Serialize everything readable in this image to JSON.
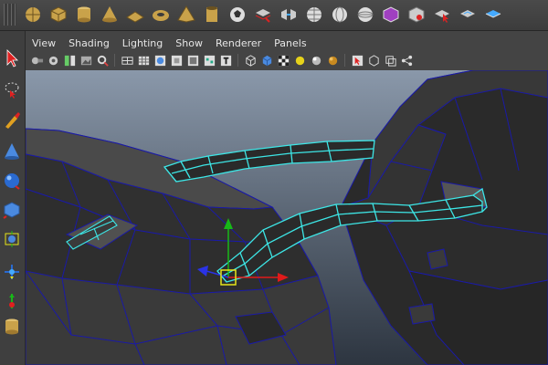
{
  "shelf": {
    "icons": [
      "sphere-icon",
      "cube-icon",
      "cylinder-icon",
      "cone-icon",
      "plane-icon",
      "torus-icon",
      "pyramid-icon",
      "pipe-icon",
      "soccer-ball-icon",
      "extrude-icon",
      "bridge-icon",
      "sphere-uv-icon",
      "mesh-icon",
      "mesh-detail-icon",
      "texture-box-icon",
      "merge-icon",
      "select-cursor-icon",
      "uv-editor-icon",
      "uv-planar-icon"
    ]
  },
  "toolbox": {
    "tools": [
      "select-tool-icon",
      "lasso-tool-icon",
      "paint-tool-icon",
      "cone-tool-icon",
      "sphere-tool-icon",
      "cube-tool-icon",
      "scale-box-icon",
      "move-manipulator-icon",
      "rotate-manipulator-icon",
      "cylinder-tool-icon"
    ]
  },
  "menus": [
    "View",
    "Shading",
    "Lighting",
    "Show",
    "Renderer",
    "Panels"
  ],
  "colors": {
    "wire": "#1a1aa6",
    "selection": "#3de6e6",
    "background_top": "#8a98aa",
    "background_bottom": "#2d3540",
    "gizmo_x": "#e01a1a",
    "gizmo_y": "#18b818",
    "gizmo_z": "#2a33e6",
    "gizmo_center": "#e6e61a"
  }
}
